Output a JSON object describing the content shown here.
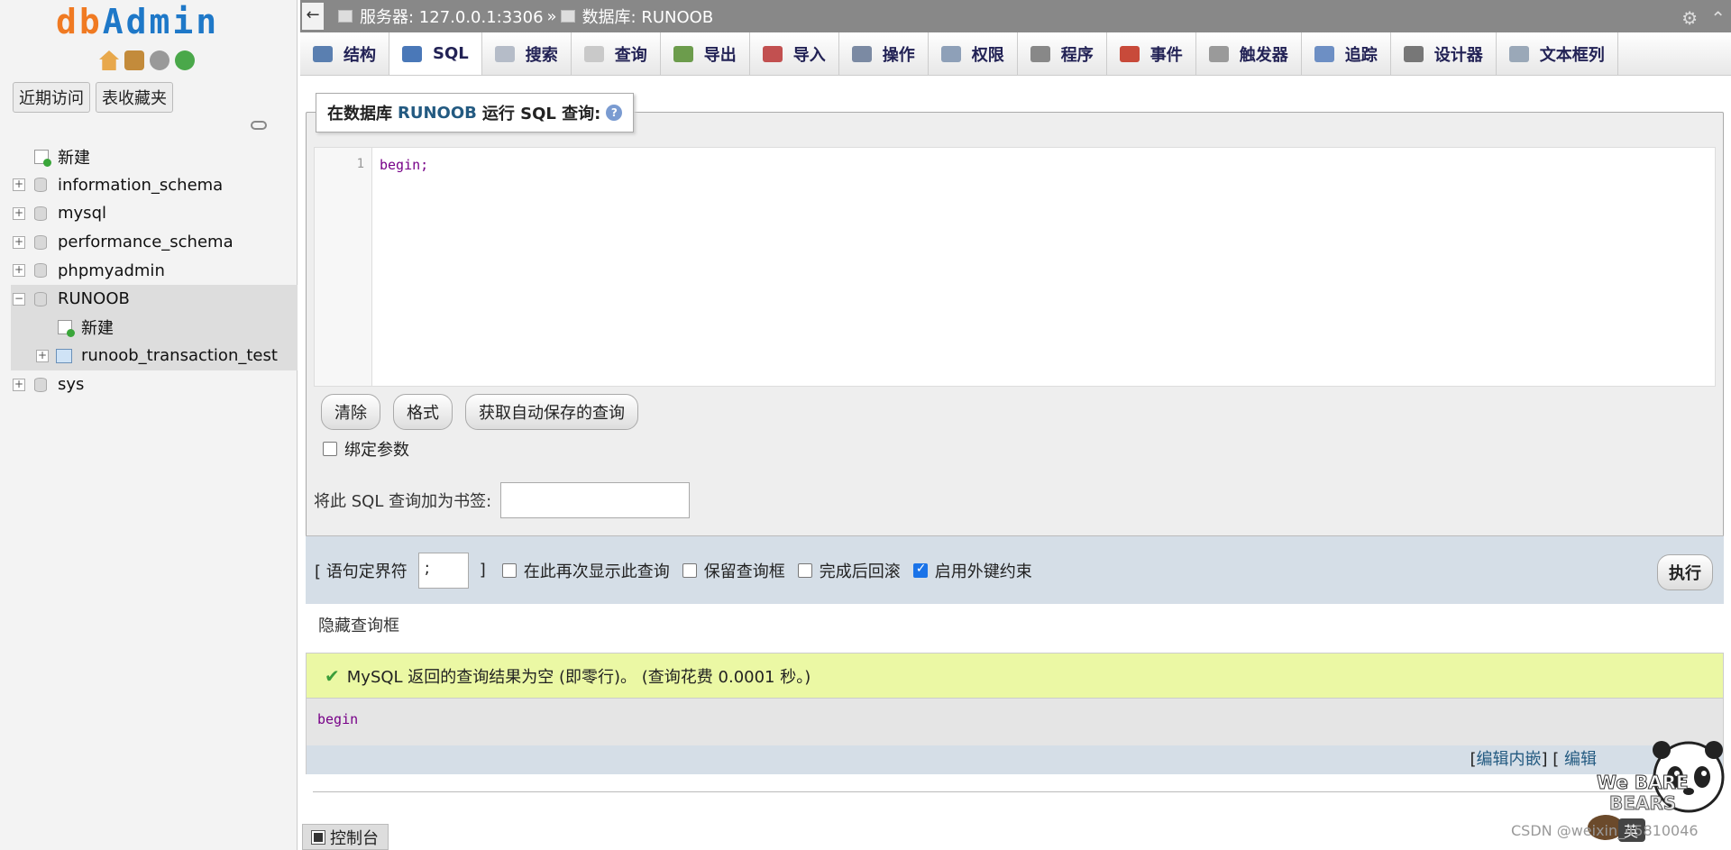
{
  "sidebar": {
    "logo_part1": "db",
    "logo_part2": "Admin",
    "tabs": [
      {
        "label": "近期访问"
      },
      {
        "label": "表收藏夹"
      }
    ],
    "tree": [
      {
        "label": "新建",
        "type": "new"
      },
      {
        "label": "information_schema",
        "type": "db"
      },
      {
        "label": "mysql",
        "type": "db"
      },
      {
        "label": "performance_schema",
        "type": "db"
      },
      {
        "label": "phpmyadmin",
        "type": "db"
      },
      {
        "label": "RUNOOB",
        "type": "db",
        "expanded": true,
        "selected": true
      },
      {
        "label": "新建",
        "type": "child-new"
      },
      {
        "label": "runoob_transaction_test",
        "type": "child-table"
      },
      {
        "label": "sys",
        "type": "db"
      }
    ]
  },
  "header": {
    "back_symbol": "←",
    "server_label": "服务器: 127.0.0.1:3306",
    "separator": "»",
    "db_label": "数据库: RUNOOB",
    "gear_symbol": "⚙",
    "collapse_symbol": "⌃"
  },
  "menu": [
    {
      "label": "结构",
      "color": "#5a7fb0"
    },
    {
      "label": "SQL",
      "color": "#4a78b8",
      "active": true
    },
    {
      "label": "搜索",
      "color": "#b5bcc8"
    },
    {
      "label": "查询",
      "color": "#c9c9c9"
    },
    {
      "label": "导出",
      "color": "#6c9c4c"
    },
    {
      "label": "导入",
      "color": "#c25050"
    },
    {
      "label": "操作",
      "color": "#7b8aa3"
    },
    {
      "label": "权限",
      "color": "#8ea0b8"
    },
    {
      "label": "程序",
      "color": "#888888"
    },
    {
      "label": "事件",
      "color": "#c84a3a"
    },
    {
      "label": "触发器",
      "color": "#9a9a9a"
    },
    {
      "label": "追踪",
      "color": "#6d8fc4"
    },
    {
      "label": "设计器",
      "color": "#777777"
    },
    {
      "label": "文本框列",
      "color": "#9aa8b8"
    }
  ],
  "sql_panel": {
    "legend_prefix": "在数据库",
    "legend_db": "RUNOOB",
    "legend_suffix": "运行 SQL 查询:",
    "help_symbol": "?",
    "line_number": "1",
    "code": "begin;",
    "buttons": {
      "clear": "清除",
      "format": "格式",
      "autosave": "获取自动保存的查询"
    },
    "bind_params_label": "绑定参数",
    "bookmark_label": "将此 SQL 查询加为书签:",
    "bookmark_value": "",
    "delimiter_label_open": "[ 语句定界符",
    "delimiter_value": ";",
    "delimiter_label_close": "]",
    "options": [
      {
        "label": "在此再次显示此查询",
        "checked": false
      },
      {
        "label": "保留查询框",
        "checked": false
      },
      {
        "label": "完成后回滚",
        "checked": false
      },
      {
        "label": "启用外键约束",
        "checked": true
      }
    ],
    "go_label": "执行"
  },
  "hide_query_box": "隐藏查询框",
  "result": {
    "message": "MySQL 返回的查询结果为空 (即零行)。 (查询花费 0.0001 秒。)",
    "sql": "begin",
    "link_inline_open": "[",
    "link_inline": "编辑内嵌",
    "link_inline_close": "] [",
    "link_edit": "编辑"
  },
  "console_label": "控制台",
  "watermark": "CSDN @weixin_45810046"
}
